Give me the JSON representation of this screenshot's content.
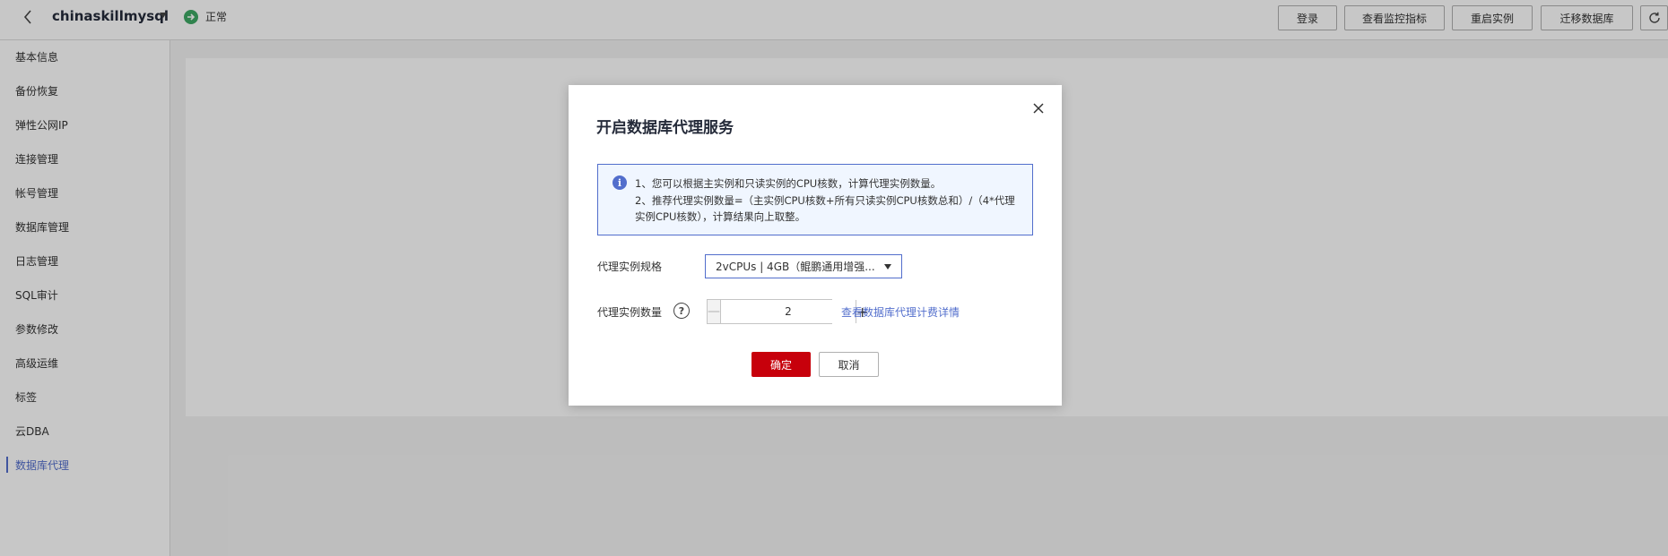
{
  "header": {
    "instance_name": "chinaskillmysql",
    "status_text": "正常",
    "status_color": "#3ea864",
    "buttons": {
      "login": "登录",
      "monitor": "查看监控指标",
      "restart": "重启实例",
      "migrate": "迁移数据库"
    },
    "icons": {
      "back": "chevron-left-icon",
      "dropdown": "caret-down-icon",
      "status": "arrow-right-circle-icon",
      "refresh": "refresh-icon"
    }
  },
  "sidebar": {
    "items": [
      {
        "label": "基本信息",
        "active": false
      },
      {
        "label": "备份恢复",
        "active": false
      },
      {
        "label": "弹性公网IP",
        "active": false
      },
      {
        "label": "连接管理",
        "active": false
      },
      {
        "label": "帐号管理",
        "active": false
      },
      {
        "label": "数据库管理",
        "active": false
      },
      {
        "label": "日志管理",
        "active": false
      },
      {
        "label": "SQL审计",
        "active": false
      },
      {
        "label": "参数修改",
        "active": false
      },
      {
        "label": "高级运维",
        "active": false
      },
      {
        "label": "标签",
        "active": false
      },
      {
        "label": "云DBA",
        "active": false
      },
      {
        "label": "数据库代理",
        "active": true
      }
    ],
    "active_color": "#526ecc"
  },
  "modal": {
    "title": "开启数据库代理服务",
    "info": {
      "line1": "1、您可以根据主实例和只读实例的CPU核数，计算代理实例数量。",
      "line2": "2、推荐代理实例数量=（主实例CPU核数+所有只读实例CPU核数总和）/（4*代理实例CPU核数），计算结果向上取整。"
    },
    "fields": {
      "spec_label": "代理实例规格",
      "spec_value": "2vCPUs | 4GB（鲲鹏通用增强...",
      "count_label": "代理实例数量",
      "count_value": "2",
      "pricing_link": "查看数据库代理计费详情"
    },
    "buttons": {
      "confirm": "确定",
      "cancel": "取消"
    },
    "colors": {
      "primary": "#c7000b",
      "info_border": "#526ecc",
      "info_bg": "#f0f6ff",
      "link": "#526ecc"
    }
  }
}
